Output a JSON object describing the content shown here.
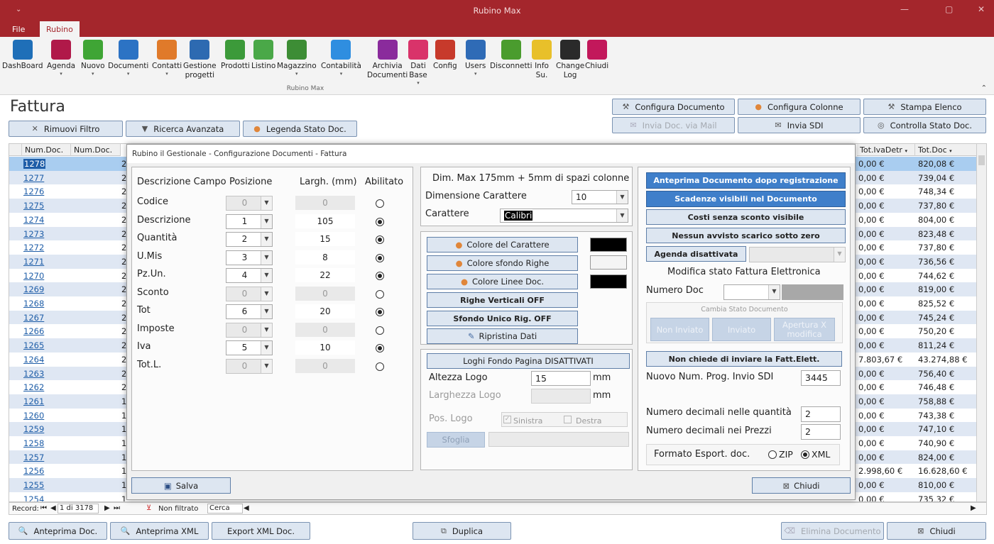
{
  "window": {
    "title": "Rubino Max",
    "qat": "⌄"
  },
  "menu": {
    "tabs": [
      "File",
      "Rubino"
    ],
    "active": 1
  },
  "ribbon": {
    "group_label": "Rubino Max",
    "buttons": [
      {
        "label": "DashBoard",
        "sub": "",
        "icon": "laptop-icon",
        "color": "#1f6fb8",
        "dd": false
      },
      {
        "label": "Agenda",
        "sub": "",
        "icon": "agenda-icon",
        "color": "#b01949",
        "dd": true
      },
      {
        "label": "Nuovo",
        "sub": "",
        "icon": "new-badge-icon",
        "color": "#3fa535",
        "dd": true
      },
      {
        "label": "Documenti",
        "sub": "",
        "icon": "documents-icon",
        "color": "#2c73c4",
        "dd": true
      },
      {
        "label": "Contatti",
        "sub": "",
        "icon": "contacts-icon",
        "color": "#e07a2a",
        "dd": true
      },
      {
        "label": "Gestione",
        "sub": "progetti",
        "icon": "projects-icon",
        "color": "#2d6ab1",
        "dd": false
      },
      {
        "label": "Prodotti",
        "sub": "",
        "icon": "products-icon",
        "color": "#3c9a3a",
        "dd": false
      },
      {
        "label": "Listino",
        "sub": "",
        "icon": "pricelist-icon",
        "color": "#4aa848",
        "dd": false
      },
      {
        "label": "Magazzino",
        "sub": "",
        "icon": "warehouse-cart-icon",
        "color": "#3d8d35",
        "dd": true
      },
      {
        "label": "Contabilità",
        "sub": "",
        "icon": "accounting-bag-icon",
        "color": "#2f8ee0",
        "dd": true
      },
      {
        "label": "Archivia",
        "sub": "Documenti",
        "icon": "archive-bag-icon",
        "color": "#8a2b9c",
        "dd": false
      },
      {
        "label": "Dati",
        "sub": "Base",
        "icon": "database-icon",
        "color": "#d9336a",
        "dd": true
      },
      {
        "label": "Config",
        "sub": "",
        "icon": "tools-icon",
        "color": "#c73a2b",
        "dd": false
      },
      {
        "label": "Users",
        "sub": "",
        "icon": "users-icon",
        "color": "#2f6bb6",
        "dd": true
      },
      {
        "label": "Disconnetti",
        "sub": "",
        "icon": "key-icon",
        "color": "#4a9c2e",
        "dd": false
      },
      {
        "label": "Info",
        "sub": "Su.",
        "icon": "info-icon",
        "color": "#e8c02a",
        "dd": false
      },
      {
        "label": "Change",
        "sub": "Log",
        "icon": "globe-icon",
        "color": "#2a2a2a",
        "dd": false
      },
      {
        "label": "Chiudi",
        "sub": "",
        "icon": "exit-door-icon",
        "color": "#c2185b",
        "dd": false
      }
    ]
  },
  "page": {
    "title": "Fattura"
  },
  "toolbar": {
    "remove_filter": "Rimuovi Filtro",
    "advanced_search": "Ricerca Avanzata",
    "legend": "Legenda Stato Doc.",
    "configure_doc": "Configura Documento",
    "configure_cols": "Configura Colonne",
    "print_list": "Stampa Elenco",
    "send_mail": "Invia Doc. via Mail",
    "send_sdi": "Invia SDI",
    "check_status": "Controlla Stato Doc."
  },
  "grid": {
    "headers": {
      "num": "Num.Doc.",
      "num2": "Num.Doc.",
      "iva": "Tot.IvaDetr",
      "tot": "Tot.Doc"
    },
    "rows": [
      {
        "num": "1278",
        "c2": "2",
        "iva": "0,00 €",
        "tot": "820,08 €"
      },
      {
        "num": "1277",
        "c2": "2",
        "iva": "0,00 €",
        "tot": "739,04 €"
      },
      {
        "num": "1276",
        "c2": "2",
        "iva": "0,00 €",
        "tot": "748,34 €"
      },
      {
        "num": "1275",
        "c2": "2",
        "iva": "0,00 €",
        "tot": "737,80 €"
      },
      {
        "num": "1274",
        "c2": "2",
        "iva": "0,00 €",
        "tot": "804,00 €"
      },
      {
        "num": "1273",
        "c2": "2",
        "iva": "0,00 €",
        "tot": "823,48 €"
      },
      {
        "num": "1272",
        "c2": "2",
        "iva": "0,00 €",
        "tot": "737,80 €"
      },
      {
        "num": "1271",
        "c2": "2",
        "iva": "0,00 €",
        "tot": "736,56 €"
      },
      {
        "num": "1270",
        "c2": "2",
        "iva": "0,00 €",
        "tot": "744,62 €"
      },
      {
        "num": "1269",
        "c2": "2",
        "iva": "0,00 €",
        "tot": "819,00 €"
      },
      {
        "num": "1268",
        "c2": "2",
        "iva": "0,00 €",
        "tot": "825,52 €"
      },
      {
        "num": "1267",
        "c2": "2",
        "iva": "0,00 €",
        "tot": "745,24 €"
      },
      {
        "num": "1266",
        "c2": "2",
        "iva": "0,00 €",
        "tot": "750,20 €"
      },
      {
        "num": "1265",
        "c2": "2",
        "iva": "0,00 €",
        "tot": "811,24 €"
      },
      {
        "num": "1264",
        "c2": "2",
        "iva": "7.803,67 €",
        "tot": "43.274,88 €"
      },
      {
        "num": "1263",
        "c2": "2",
        "iva": "0,00 €",
        "tot": "756,40 €"
      },
      {
        "num": "1262",
        "c2": "2",
        "iva": "0,00 €",
        "tot": "746,48 €"
      },
      {
        "num": "1261",
        "c2": "1",
        "iva": "0,00 €",
        "tot": "758,88 €"
      },
      {
        "num": "1260",
        "c2": "1",
        "iva": "0,00 €",
        "tot": "743,38 €"
      },
      {
        "num": "1259",
        "c2": "1",
        "iva": "0,00 €",
        "tot": "747,10 €"
      },
      {
        "num": "1258",
        "c2": "1",
        "iva": "0,00 €",
        "tot": "740,90 €"
      },
      {
        "num": "1257",
        "c2": "1",
        "iva": "0,00 €",
        "tot": "824,00 €"
      },
      {
        "num": "1256",
        "c2": "1",
        "iva": "2.998,60 €",
        "tot": "16.628,60 €"
      },
      {
        "num": "1255",
        "c2": "1",
        "iva": "0,00 €",
        "tot": "810,00 €"
      },
      {
        "num": "1254",
        "c2": "1",
        "iva": "0,00 €",
        "tot": "735,32 €"
      }
    ]
  },
  "navbar": {
    "record_label": "Record:",
    "position": "1 di 3178",
    "filter": "Non filtrato",
    "search": "Cerca"
  },
  "dialog": {
    "title": "Rubino il Gestionale - Configurazione Documenti - Fattura",
    "fields_header": {
      "desc": "Descrizione Campo",
      "pos": "Posizione",
      "width": "Largh. (mm)",
      "enabled": "Abilitato"
    },
    "fields": [
      {
        "name": "Codice",
        "pos": "0",
        "width": "0",
        "enabled": false
      },
      {
        "name": "Descrizione",
        "pos": "1",
        "width": "105",
        "enabled": true
      },
      {
        "name": "Quantità",
        "pos": "2",
        "width": "15",
        "enabled": true
      },
      {
        "name": "U.Mis",
        "pos": "3",
        "width": "8",
        "enabled": true
      },
      {
        "name": "Pz.Un.",
        "pos": "4",
        "width": "22",
        "enabled": true
      },
      {
        "name": "Sconto",
        "pos": "0",
        "width": "0",
        "enabled": false
      },
      {
        "name": "Tot",
        "pos": "6",
        "width": "20",
        "enabled": true
      },
      {
        "name": "Imposte",
        "pos": "0",
        "width": "0",
        "enabled": false
      },
      {
        "name": "Iva",
        "pos": "5",
        "width": "10",
        "enabled": true
      },
      {
        "name": "Tot.L.",
        "pos": "0",
        "width": "0",
        "enabled": false
      }
    ],
    "font": {
      "note": "Dim. Max 175mm + 5mm di spazi colonne",
      "size_label": "Dimensione Carattere",
      "size_value": "10",
      "font_label": "Carattere",
      "font_value": "Calibri"
    },
    "colors": {
      "text_color": "Colore del Carattere",
      "text_swatch": "#000000",
      "row_bg": "Colore sfondo Righe",
      "row_swatch": "#f4f4f4",
      "line_color": "Colore Linee Doc.",
      "line_swatch": "#000000",
      "vertical_lines": "Righe Verticali OFF",
      "single_bg": "Sfondo Unico Rig. OFF",
      "restore": "Ripristina Dati"
    },
    "logo": {
      "footer_logos": "Loghi Fondo Pagina DISATTIVATI",
      "height_label": "Altezza Logo",
      "height_value": "15",
      "unit": "mm",
      "width_label": "Larghezza Logo",
      "width_unit": "mm",
      "pos_label": "Pos. Logo",
      "left": "Sinistra",
      "right": "Destra",
      "browse": "Sfoglia"
    },
    "options": {
      "preview_after_save": "Anteprima Documento dopo registrazione",
      "due_dates": "Scadenze visibili nel Documento",
      "costs": "Costi senza sconto visibile",
      "no_warning": "Nessun avvisto scarico sotto zero",
      "agenda": "Agenda disattivata",
      "edit_state_title": "Modifica stato Fattura Elettronica",
      "doc_number": "Numero Doc",
      "change_state": "Cambia Stato Documento",
      "not_sent": "Non Inviato",
      "sent": "Inviato",
      "open_edit": "Apertura X modifica",
      "no_ask": "Non chiede di inviare la Fatt.Elett.",
      "prog_label": "Nuovo Num. Prog. Invio SDI",
      "prog_value": "3445",
      "dec_qty_label": "Numero decimali nelle quantità",
      "dec_qty": "2",
      "dec_price_label": "Numero decimali nei Prezzi",
      "dec_price": "2",
      "export_label": "Formato Esport. doc.",
      "zip": "ZIP",
      "xml": "XML"
    },
    "save": "Salva",
    "close": "Chiudi"
  },
  "bottom": {
    "preview_doc": "Anteprima Doc.",
    "preview_xml": "Anteprima XML",
    "export_xml": "Export XML Doc.",
    "duplicate": "Duplica",
    "delete": "Elimina Documento",
    "close": "Chiudi"
  }
}
